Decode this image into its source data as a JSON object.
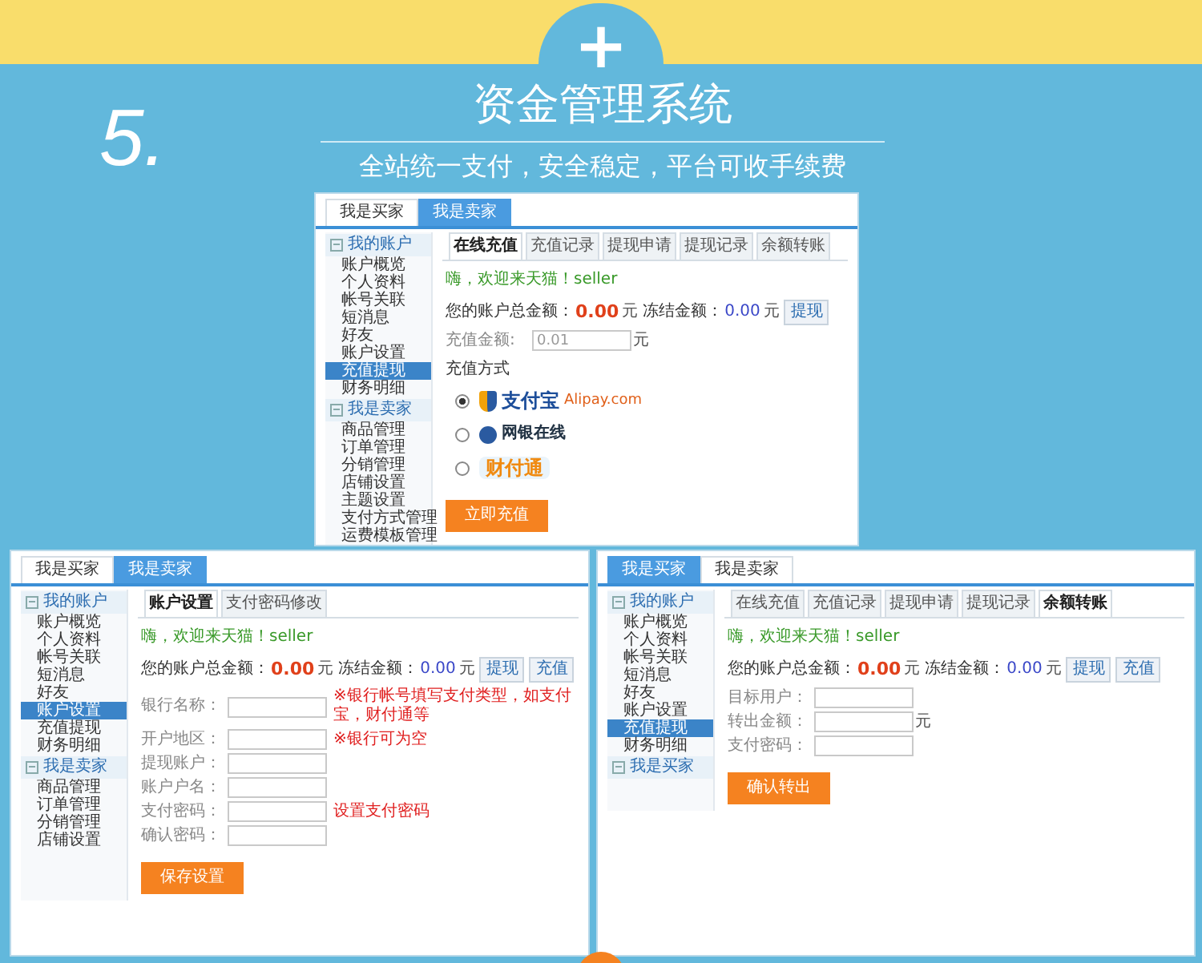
{
  "header": {
    "badge": "+",
    "number": "5.",
    "title": "资金管理系统",
    "subtitle": "全站统一支付，安全稳定，平台可收手续费"
  },
  "windows": [
    {
      "top_tabs": [
        {
          "label": "我是买家",
          "selected": false
        },
        {
          "label": "我是卖家",
          "selected": true
        }
      ],
      "sidebar": [
        {
          "label": "我的账户",
          "items": [
            {
              "label": "账户概览",
              "selected": false
            },
            {
              "label": "个人资料",
              "selected": false
            },
            {
              "label": "帐号关联",
              "selected": false
            },
            {
              "label": "短消息",
              "selected": false
            },
            {
              "label": "好友",
              "selected": false
            },
            {
              "label": "账户设置",
              "selected": false
            },
            {
              "label": "充值提现",
              "selected": true
            },
            {
              "label": "财务明细",
              "selected": false
            }
          ]
        },
        {
          "label": "我是卖家",
          "items": [
            {
              "label": "商品管理",
              "selected": false
            },
            {
              "label": "订单管理",
              "selected": false
            },
            {
              "label": "分销管理",
              "selected": false
            },
            {
              "label": "店铺设置",
              "selected": false
            },
            {
              "label": "主题设置",
              "selected": false
            },
            {
              "label": "支付方式管理",
              "selected": false
            },
            {
              "label": "运费模板管理",
              "selected": false
            }
          ]
        }
      ],
      "tabs": [
        {
          "label": "在线充值",
          "selected": true
        },
        {
          "label": "充值记录",
          "selected": false
        },
        {
          "label": "提现申请",
          "selected": false
        },
        {
          "label": "提现记录",
          "selected": false
        },
        {
          "label": "余额转账",
          "selected": false
        }
      ],
      "greeting": "嗨，欢迎来天猫！seller",
      "balance": {
        "label": "您的账户总金额：",
        "amount": "0.00",
        "unit": "元",
        "frozen_label": "冻结金额：",
        "frozen_amount": "0.00",
        "frozen_unit": "元"
      },
      "balance_buttons": [
        "提现"
      ],
      "fields": [
        {
          "label": "充值金额:",
          "value": "0.01",
          "unit": "元"
        }
      ],
      "payment": {
        "title": "充值方式",
        "options": [
          {
            "kind": "alipay",
            "selected": true,
            "name": "支付宝",
            "site": "Alipay.com"
          },
          {
            "kind": "chinabank",
            "selected": false,
            "name": "网银在线"
          },
          {
            "kind": "tenpay",
            "selected": false,
            "name": "财付通"
          }
        ]
      },
      "submit": "立即充值"
    },
    {
      "top_tabs": [
        {
          "label": "我是买家",
          "selected": false
        },
        {
          "label": "我是卖家",
          "selected": true
        }
      ],
      "sidebar": [
        {
          "label": "我的账户",
          "items": [
            {
              "label": "账户概览",
              "selected": false
            },
            {
              "label": "个人资料",
              "selected": false
            },
            {
              "label": "帐号关联",
              "selected": false
            },
            {
              "label": "短消息",
              "selected": false
            },
            {
              "label": "好友",
              "selected": false
            },
            {
              "label": "账户设置",
              "selected": true
            },
            {
              "label": "充值提现",
              "selected": false
            },
            {
              "label": "财务明细",
              "selected": false
            }
          ]
        },
        {
          "label": "我是卖家",
          "items": [
            {
              "label": "商品管理",
              "selected": false
            },
            {
              "label": "订单管理",
              "selected": false
            },
            {
              "label": "分销管理",
              "selected": false
            },
            {
              "label": "店铺设置",
              "selected": false
            }
          ]
        }
      ],
      "tabs": [
        {
          "label": "账户设置",
          "selected": true
        },
        {
          "label": "支付密码修改",
          "selected": false
        }
      ],
      "greeting": "嗨，欢迎来天猫！seller",
      "balance": {
        "label": "您的账户总金额：",
        "amount": "0.00",
        "unit": "元",
        "frozen_label": "冻结金额：",
        "frozen_amount": "0.00",
        "frozen_unit": "元"
      },
      "balance_buttons": [
        "提现",
        "充值"
      ],
      "fields": [
        {
          "label": "银行名称：",
          "note": "※银行帐号填写支付类型，如支付宝，财付通等"
        },
        {
          "label": "开户地区：",
          "note": "※银行可为空"
        },
        {
          "label": "提现账户："
        },
        {
          "label": "账户户名："
        },
        {
          "label": "支付密码：",
          "note": "设置支付密码"
        },
        {
          "label": "确认密码："
        }
      ],
      "submit": "保存设置"
    },
    {
      "top_tabs": [
        {
          "label": "我是买家",
          "selected": true
        },
        {
          "label": "我是卖家",
          "selected": false
        }
      ],
      "sidebar": [
        {
          "label": "我的账户",
          "items": [
            {
              "label": "账户概览",
              "selected": false
            },
            {
              "label": "个人资料",
              "selected": false
            },
            {
              "label": "帐号关联",
              "selected": false
            },
            {
              "label": "短消息",
              "selected": false
            },
            {
              "label": "好友",
              "selected": false
            },
            {
              "label": "账户设置",
              "selected": false
            },
            {
              "label": "充值提现",
              "selected": true
            },
            {
              "label": "财务明细",
              "selected": false
            }
          ]
        },
        {
          "label": "我是买家"
        }
      ],
      "tabs": [
        {
          "label": "在线充值",
          "selected": false
        },
        {
          "label": "充值记录",
          "selected": false
        },
        {
          "label": "提现申请",
          "selected": false
        },
        {
          "label": "提现记录",
          "selected": false
        },
        {
          "label": "余额转账",
          "selected": true
        }
      ],
      "greeting": "嗨，欢迎来天猫！seller",
      "balance": {
        "label": "您的账户总金额：",
        "amount": "0.00",
        "unit": "元",
        "frozen_label": "冻结金额：",
        "frozen_amount": "0.00",
        "frozen_unit": "元"
      },
      "balance_buttons": [
        "提现",
        "充值"
      ],
      "fields": [
        {
          "label": "目标用户："
        },
        {
          "label": "转出金额：",
          "unit": "元"
        },
        {
          "label": "支付密码："
        }
      ],
      "submit": "确认转出"
    }
  ]
}
